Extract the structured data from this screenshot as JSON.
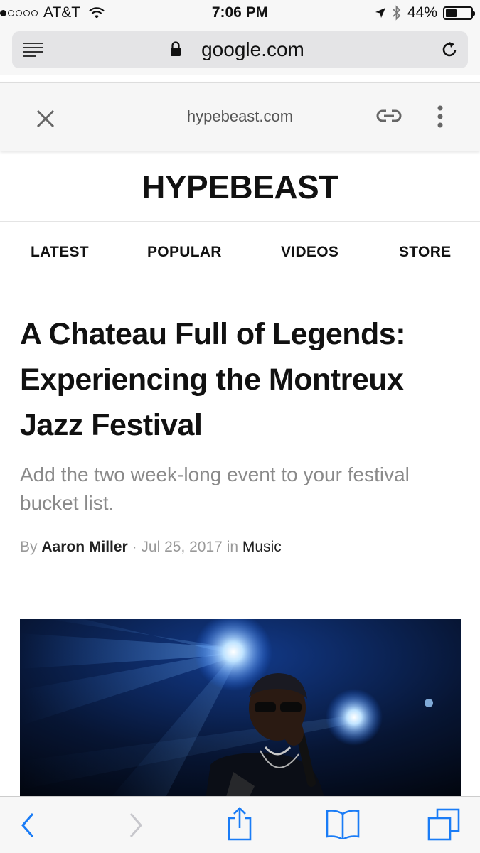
{
  "status_bar": {
    "carrier": "AT&T",
    "signal_bars_filled": 1,
    "signal_bars_total": 5,
    "time": "7:06 PM",
    "battery_percent": "44%"
  },
  "url_bar": {
    "url": "google.com"
  },
  "amp_header": {
    "domain": "hypebeast.com"
  },
  "site": {
    "logo": "HYPEBEAST"
  },
  "nav": {
    "items": [
      "LATEST",
      "POPULAR",
      "VIDEOS",
      "STORE"
    ]
  },
  "article": {
    "headline": "A Chateau Full of Legends: Experiencing the Montreux Jazz Festival",
    "subtitle": "Add the two week-long event to your festival bucket list.",
    "byline_prefix": "By",
    "author": "Aaron Miller",
    "separator": "·",
    "date": "Jul 25, 2017",
    "in_text": "in",
    "category": "Music"
  },
  "colors": {
    "ios_blue": "#1a7cf6",
    "disabled_gray": "#c7c7cc"
  }
}
